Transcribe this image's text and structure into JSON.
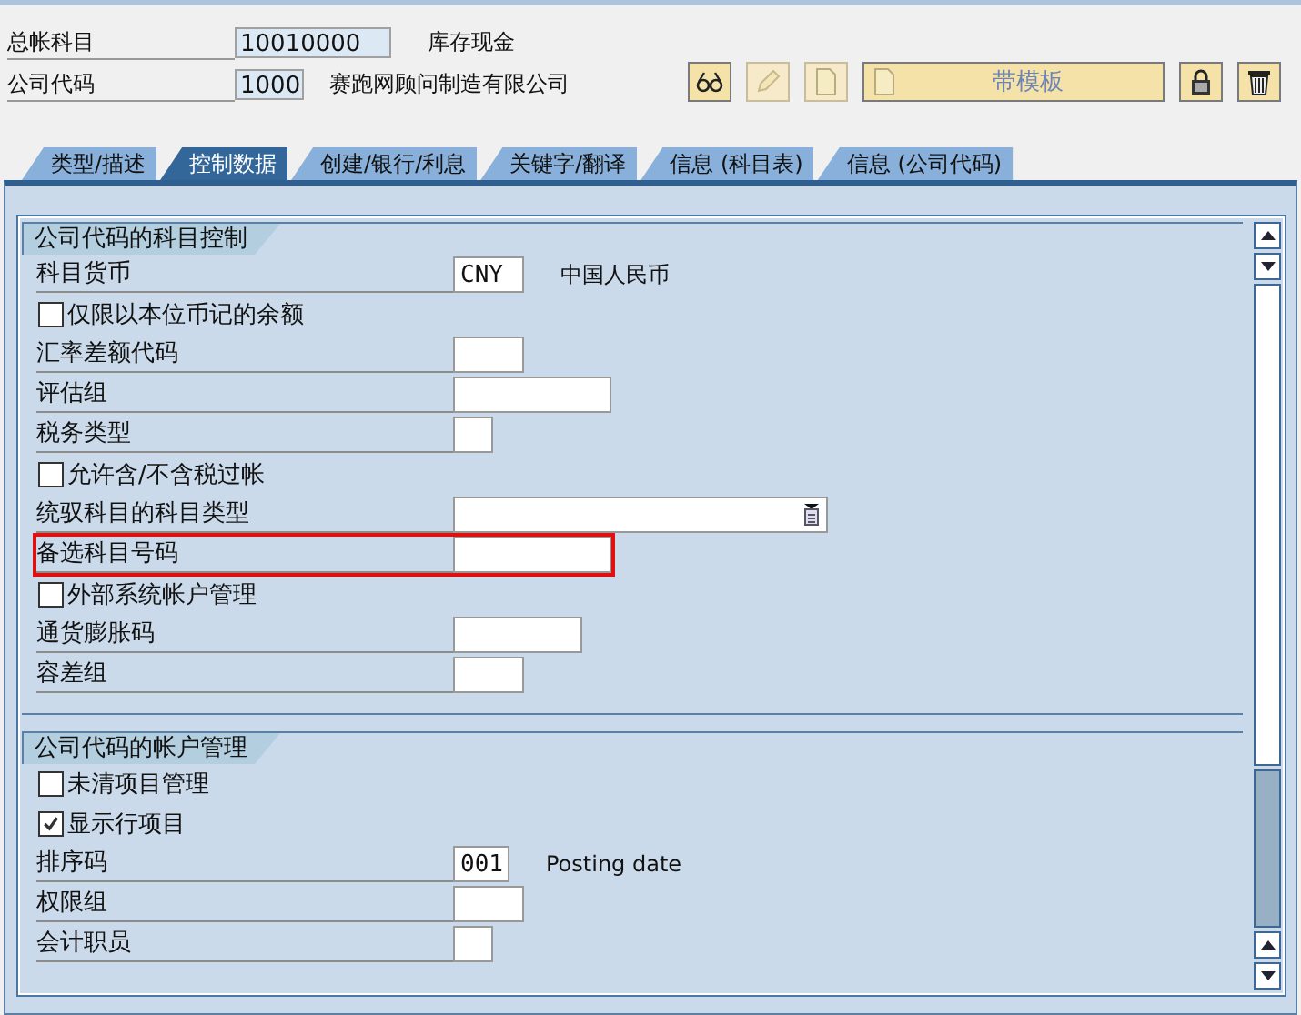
{
  "header": {
    "rows": [
      {
        "label": "总帐科目",
        "value": "10010000",
        "description": "库存现金"
      },
      {
        "label": "公司代码",
        "value": "1000",
        "description": "赛跑网顾问制造有限公司"
      }
    ]
  },
  "toolbar": [
    {
      "kind": "glasses",
      "disabled": false
    },
    {
      "kind": "pencil",
      "disabled": true
    },
    {
      "kind": "document",
      "disabled": true
    },
    {
      "kind": "template",
      "label": "带模板",
      "disabled": false
    },
    {
      "kind": "lock",
      "disabled": false
    },
    {
      "kind": "trash",
      "disabled": false
    }
  ],
  "tabs": [
    {
      "label": "类型/描述",
      "selected": false
    },
    {
      "label": "控制数据",
      "selected": true
    },
    {
      "label": "创建/银行/利息",
      "selected": false
    },
    {
      "label": "关键字/翻译",
      "selected": false
    },
    {
      "label": "信息 (科目表)",
      "selected": false
    },
    {
      "label": "信息 (公司代码)",
      "selected": false
    }
  ],
  "sections": [
    {
      "title": "公司代码的科目控制",
      "rows": [
        {
          "kind": "field",
          "label": "科目货币",
          "value": "CNY",
          "highlighted": false,
          "description": "中国人民币"
        },
        {
          "kind": "checkbox",
          "label": "仅限以本位币记的余额",
          "checked": false
        },
        {
          "kind": "field",
          "label": "汇率差额代码",
          "highlighted": false
        },
        {
          "kind": "field",
          "label": "评估组",
          "highlighted": false
        },
        {
          "kind": "field",
          "label": "税务类型",
          "highlighted": false
        },
        {
          "kind": "checkbox",
          "label": "允许含/不含税过帐",
          "checked": false
        },
        {
          "kind": "select",
          "label": "统驭科目的科目类型",
          "highlighted": false
        },
        {
          "kind": "field",
          "label": "备选科目号码",
          "highlighted": true
        },
        {
          "kind": "checkbox",
          "label": "外部系统帐户管理",
          "checked": false
        },
        {
          "kind": "field",
          "label": "通货膨胀码",
          "highlighted": false
        },
        {
          "kind": "field",
          "label": "容差组",
          "highlighted": false
        }
      ]
    },
    {
      "title": "公司代码的帐户管理",
      "rows": [
        {
          "kind": "checkbox",
          "label": "未清项目管理",
          "checked": false
        },
        {
          "kind": "checkbox",
          "label": "显示行项目",
          "checked": true
        },
        {
          "kind": "field",
          "label": "排序码",
          "value": "001",
          "highlighted": false,
          "description": "Posting date"
        },
        {
          "kind": "field",
          "label": "权限组",
          "highlighted": false
        },
        {
          "kind": "field",
          "label": "会计职员",
          "highlighted": false
        }
      ]
    }
  ]
}
